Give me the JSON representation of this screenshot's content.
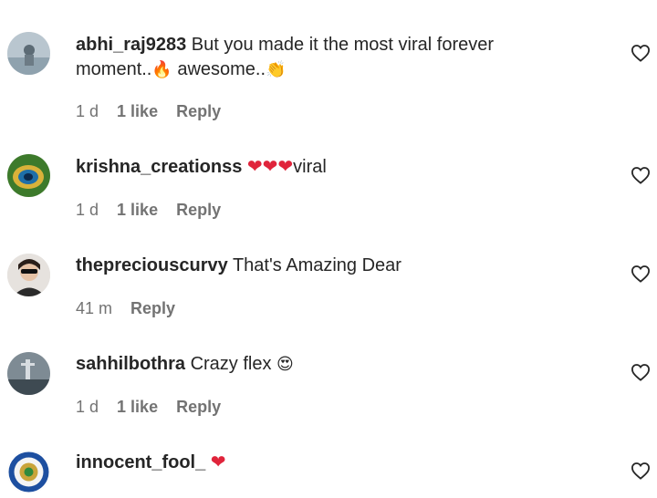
{
  "comments": [
    {
      "username": "abhi_raj9283",
      "text_line1": "But you made it the most viral forever",
      "text_line2a": "moment..",
      "emoji1": "🔥",
      "text_line2b": " awesome..",
      "emoji2": "👏",
      "time": "1 d",
      "likes": "1 like",
      "reply": "Reply"
    },
    {
      "username": "krishna_creationss",
      "hearts": "❤❤❤",
      "text": "viral",
      "time": "1 d",
      "likes": "1 like",
      "reply": "Reply"
    },
    {
      "username": "thepreciouscurvy",
      "text": "That's Amazing Dear",
      "time": "41 m",
      "reply": "Reply"
    },
    {
      "username": "sahhilbothra",
      "text": "Crazy flex",
      "emoji": "😍",
      "time": "1 d",
      "likes": "1 like",
      "reply": "Reply"
    },
    {
      "username": "innocent_fool_",
      "hearts": "❤"
    }
  ],
  "colors": {
    "heart": "#e0243b",
    "meta": "#737373",
    "text": "#262626"
  }
}
